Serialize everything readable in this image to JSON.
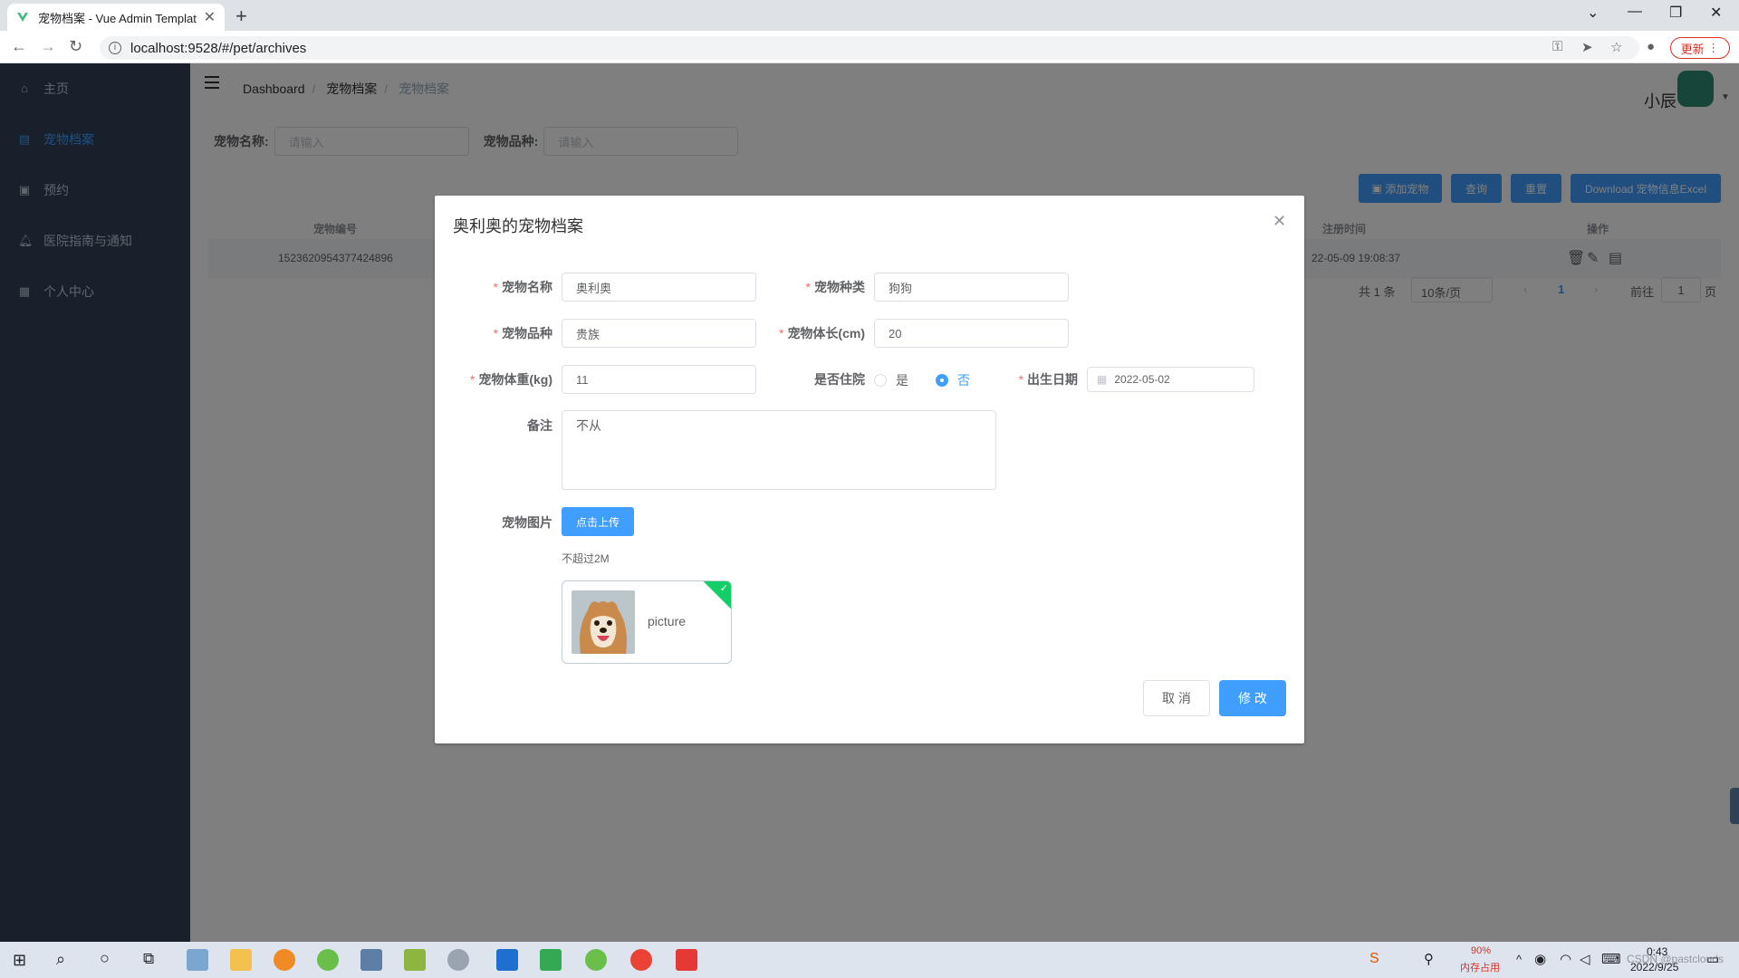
{
  "browser": {
    "tab_title": "宠物档案 - Vue Admin Templat",
    "url": "localhost:9528/#/pet/archives",
    "update_label": "更新"
  },
  "sidebar": {
    "items": [
      {
        "label": "主页",
        "icon": "home-icon"
      },
      {
        "label": "宠物档案",
        "icon": "archive-icon"
      },
      {
        "label": "预约",
        "icon": "clipboard-icon"
      },
      {
        "label": "医院指南与通知",
        "icon": "bell-icon"
      },
      {
        "label": "个人中心",
        "icon": "calendar-icon"
      }
    ],
    "active_index": 1
  },
  "header": {
    "breadcrumb": [
      "Dashboard",
      "宠物档案",
      "宠物档案"
    ],
    "user_name": "小辰"
  },
  "filters": {
    "name_label": "宠物名称:",
    "name_placeholder": "请输入",
    "breed_label": "宠物品种:",
    "breed_placeholder": "请输入"
  },
  "actions": {
    "add": "添加宠物",
    "query": "查询",
    "reset": "重置",
    "download": "Download 宠物信息Excel"
  },
  "table": {
    "columns": [
      "宠物编号",
      "注册时间",
      "操作"
    ],
    "rows": [
      {
        "id": "1523620954377424896",
        "registered": "22-05-09 19:08:37"
      }
    ]
  },
  "pagination": {
    "total": "共 1 条",
    "page_size": "10条/页",
    "current_page": "1",
    "goto_label": "前往",
    "goto_value": "1",
    "page_unit": "页"
  },
  "dialog": {
    "title": "奥利奥的宠物档案",
    "fields": {
      "name": {
        "label": "宠物名称",
        "value": "奥利奥"
      },
      "species": {
        "label": "宠物种类",
        "value": "狗狗"
      },
      "breed": {
        "label": "宠物品种",
        "value": "贵族"
      },
      "length": {
        "label": "宠物体长(cm)",
        "value": "20"
      },
      "weight": {
        "label": "宠物体重(kg)",
        "value": "11"
      },
      "hospitalized": {
        "label": "是否住院",
        "options": [
          "是",
          "否"
        ],
        "selected": "否"
      },
      "birthday": {
        "label": "出生日期",
        "value": "2022-05-02"
      },
      "remark": {
        "label": "备注",
        "value": "不从"
      },
      "picture": {
        "label": "宠物图片",
        "upload_label": "点击上传",
        "tip": "不超过2M",
        "file_name": "picture"
      }
    },
    "cancel_label": "取 消",
    "submit_label": "修 改"
  },
  "taskbar": {
    "time": "0:43",
    "date": "2022/9/25",
    "memory_percent": "90%",
    "memory_label": "内存占用",
    "watermark": "CSDN @pastclouds"
  },
  "colors": {
    "primary": "#409eff",
    "sidebar_bg": "#304156",
    "success": "#13ce66",
    "required": "#f56c6c"
  }
}
